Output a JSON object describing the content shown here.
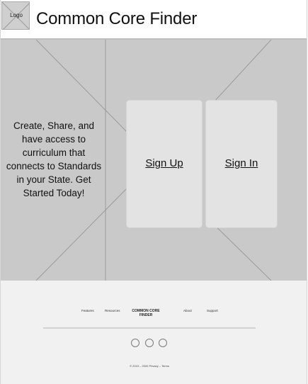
{
  "header": {
    "logo_label": "Logo",
    "title": "Common Core Finder"
  },
  "hero": {
    "tagline": "Create, Share, and have access to curriculum that connects to Standards in your State. Get Started Today!",
    "signup_label": "Sign Up",
    "signin_label": "Sign In"
  },
  "footer": {
    "links": [
      "Features",
      "Resources",
      "About",
      "Support"
    ],
    "brand_line1": "COMMON CORE",
    "brand_line2": "FINDER",
    "copyright": "© 2019 – 2020   Privacy – Terms"
  }
}
